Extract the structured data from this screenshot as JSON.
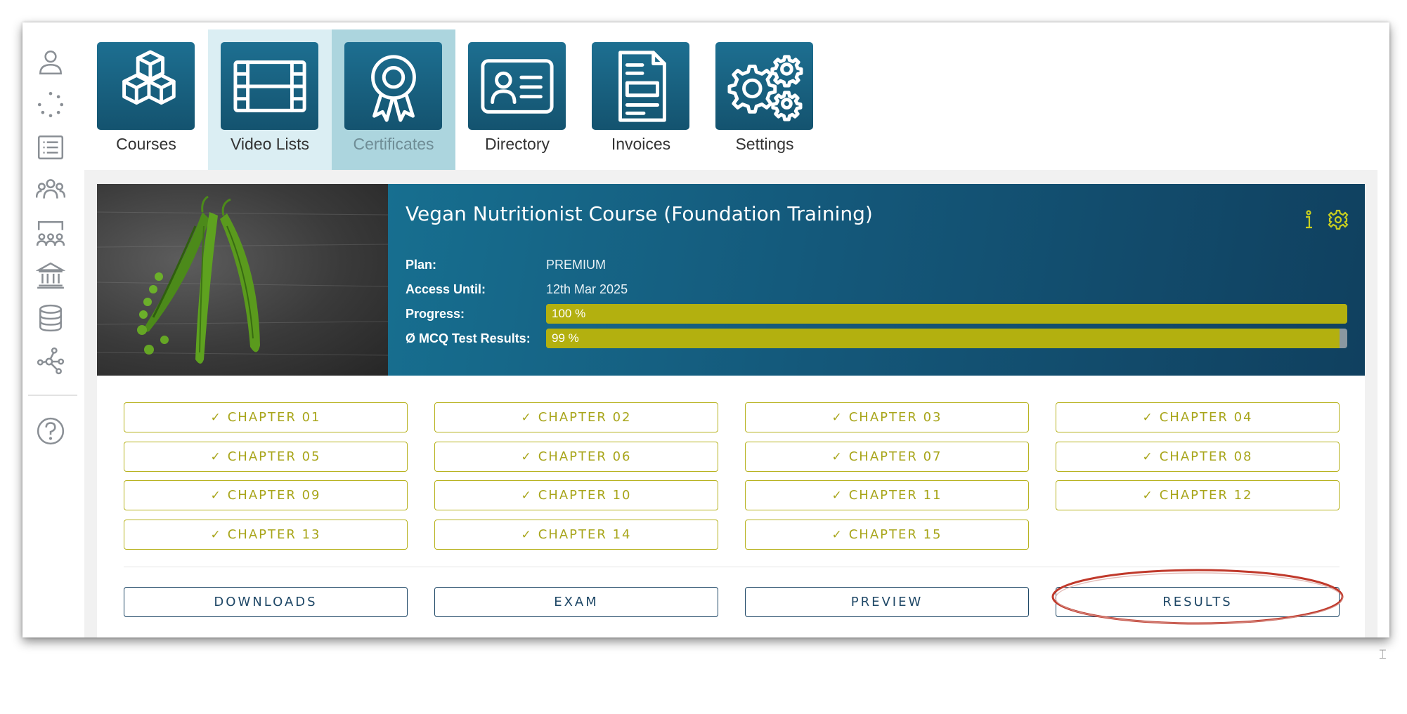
{
  "sidebar": {
    "icons": [
      "user-icon",
      "loading-dots-icon",
      "list-icon",
      "group-icon",
      "classroom-icon",
      "institution-icon",
      "database-icon",
      "network-icon",
      "help-icon"
    ]
  },
  "topnav": {
    "items": [
      {
        "label": "Courses",
        "icon": "cubes-icon"
      },
      {
        "label": "Video Lists",
        "icon": "film-icon"
      },
      {
        "label": "Certificates",
        "icon": "award-icon"
      },
      {
        "label": "Directory",
        "icon": "id-card-icon"
      },
      {
        "label": "Invoices",
        "icon": "invoice-icon"
      },
      {
        "label": "Settings",
        "icon": "gears-icon"
      }
    ]
  },
  "course": {
    "title": "Vegan Nutritionist Course (Foundation Training)",
    "plan_label": "Plan:",
    "plan_value": "PREMIUM",
    "access_label": "Access Until:",
    "access_value": "12th Mar 2025",
    "progress_label": "Progress:",
    "progress_text": "100 %",
    "progress_value": 100,
    "mcq_label": "Ø MCQ Test Results:",
    "mcq_text": "99 %",
    "mcq_value": 99,
    "accent_color": "#b3b00f"
  },
  "chapters": [
    "CHAPTER 01",
    "CHAPTER 02",
    "CHAPTER 03",
    "CHAPTER 04",
    "CHAPTER 05",
    "CHAPTER 06",
    "CHAPTER 07",
    "CHAPTER 08",
    "CHAPTER 09",
    "CHAPTER 10",
    "CHAPTER 11",
    "CHAPTER 12",
    "CHAPTER 13",
    "CHAPTER 14",
    "CHAPTER 15"
  ],
  "chapter_check": "✓",
  "actions": {
    "downloads": "DOWNLOADS",
    "exam": "EXAM",
    "preview": "PREVIEW",
    "results": "RESULTS"
  },
  "resize_glyph": "⌶"
}
